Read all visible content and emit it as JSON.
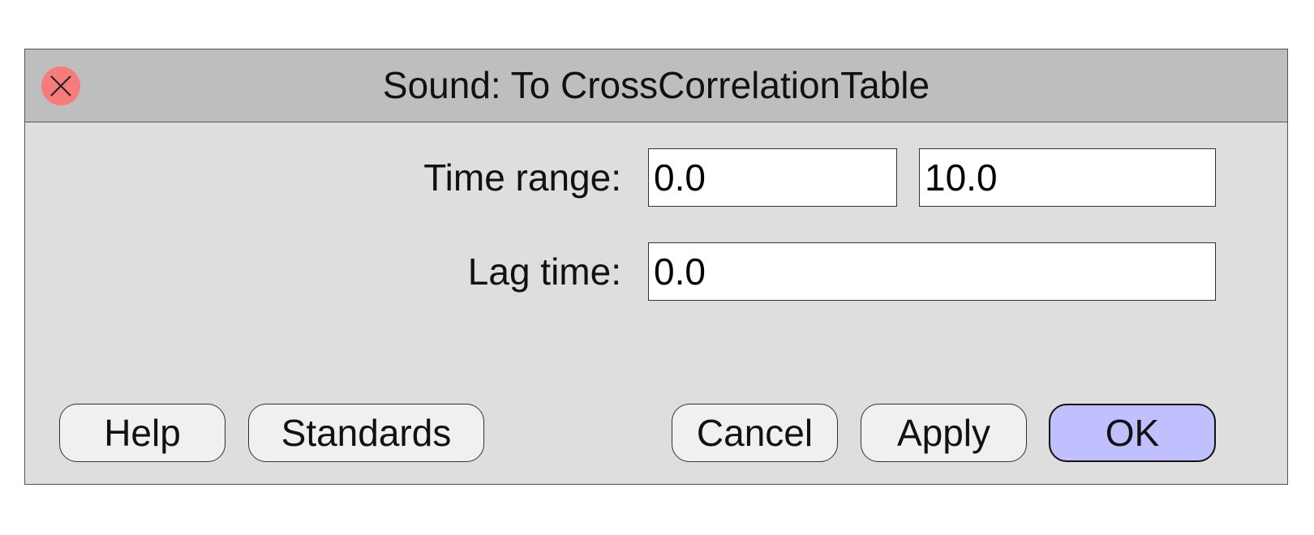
{
  "dialog": {
    "title": "Sound: To CrossCorrelationTable",
    "close_icon": "close-x-icon"
  },
  "fields": {
    "time_range": {
      "label": "Time range:",
      "from_value": "0.0",
      "to_value": "10.0"
    },
    "lag_time": {
      "label": "Lag time:",
      "value": "0.0"
    }
  },
  "buttons": {
    "help": "Help",
    "standards": "Standards",
    "cancel": "Cancel",
    "apply": "Apply",
    "ok": "OK"
  },
  "colors": {
    "titlebar": "#bebebe",
    "dialog_bg": "#dedede",
    "close_button": "#f67b7b",
    "ok_button": "#c0c0ff"
  }
}
